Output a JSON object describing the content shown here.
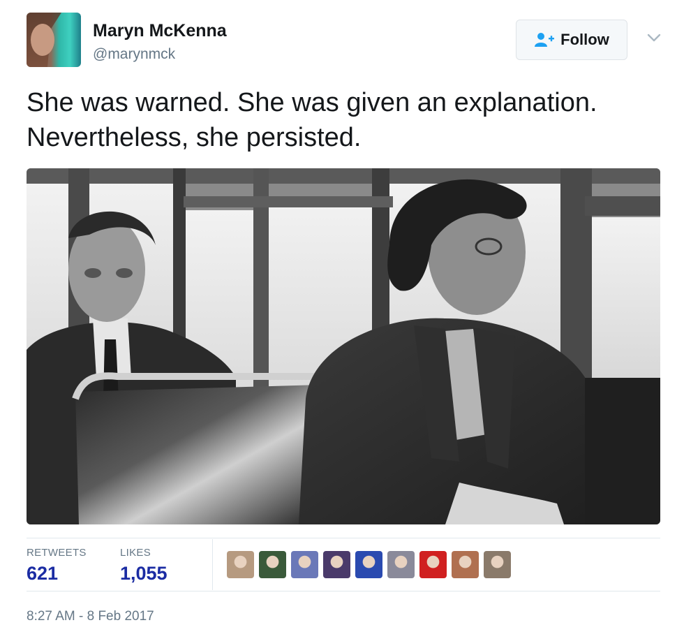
{
  "tweet": {
    "author_name": "Maryn McKenna",
    "author_handle": "@marynmck",
    "follow_label": "Follow",
    "text_line1": "She was warned. She was given an explanation.",
    "text_line2": "Nevertheless, she persisted.",
    "timestamp": "8:27 AM - 8 Feb 2017"
  },
  "stats": {
    "retweets_label": "RETWEETS",
    "retweets_value": "621",
    "likes_label": "LIKES",
    "likes_value": "1,055"
  },
  "likers": [
    {
      "icon": "liker-avatar-1",
      "color": "#b69a80"
    },
    {
      "icon": "liker-avatar-2",
      "color": "#3a5a3a"
    },
    {
      "icon": "liker-avatar-3",
      "color": "#6a78b8"
    },
    {
      "icon": "liker-avatar-4",
      "color": "#4a3a6a"
    },
    {
      "icon": "liker-avatar-5",
      "color": "#2a4ab0"
    },
    {
      "icon": "liker-avatar-6",
      "color": "#8a8a9a"
    },
    {
      "icon": "liker-avatar-7",
      "color": "#d02020"
    },
    {
      "icon": "liker-avatar-8",
      "color": "#b07050"
    },
    {
      "icon": "liker-avatar-9",
      "color": "#8a7a6a"
    }
  ],
  "colors": {
    "accent": "#1b2ca3",
    "muted": "#657786",
    "follow_icon": "#1da1f2"
  }
}
